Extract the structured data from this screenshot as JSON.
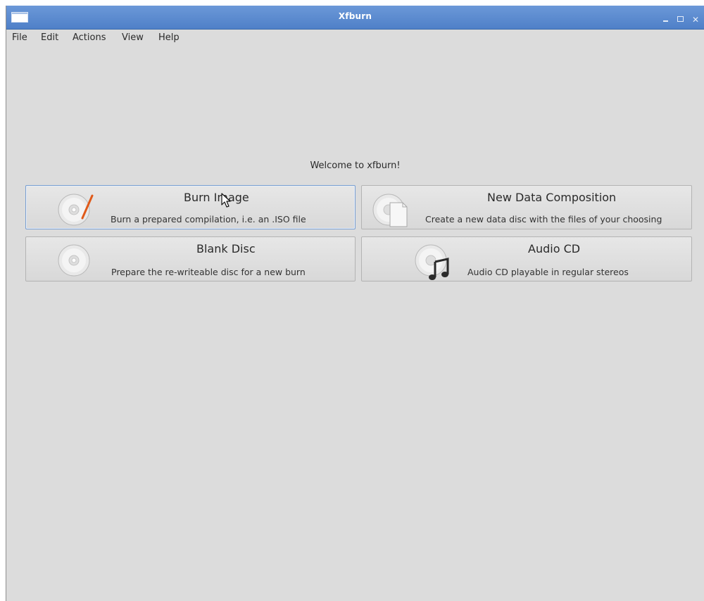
{
  "window": {
    "title": "Xfburn"
  },
  "menu": [
    "File",
    "Edit",
    "Actions",
    "View",
    "Help"
  ],
  "welcome": "Welcome to xfburn!",
  "actions": {
    "burn_image": {
      "title": "Burn Image",
      "desc": "Burn a prepared compilation, i.e. an .ISO file",
      "icon": "disc-burn-icon"
    },
    "new_data": {
      "title": "New Data Composition",
      "desc": "Create a new data disc with the files of your choosing",
      "icon": "disc-document-icon"
    },
    "blank_disc": {
      "title": "Blank Disc",
      "desc": "Prepare the re-writeable disc for a new burn",
      "icon": "disc-icon"
    },
    "audio_cd": {
      "title": "Audio CD",
      "desc": "Audio CD playable in regular stereos",
      "icon": "disc-music-icon"
    }
  }
}
